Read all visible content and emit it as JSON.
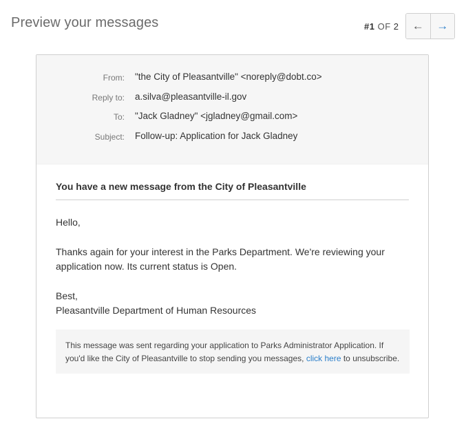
{
  "header": {
    "title": "Preview your messages",
    "pager": {
      "current": "#1",
      "of_label": "OF",
      "total": "2"
    },
    "nav": {
      "prev_glyph": "←",
      "next_glyph": "→"
    }
  },
  "email": {
    "headers": [
      {
        "label": "From:",
        "value": "\"the City of Pleasantville\" <noreply@dobt.co>"
      },
      {
        "label": "Reply to:",
        "value": "a.silva@pleasantville-il.gov"
      },
      {
        "label": "To:",
        "value": "\"Jack Gladney\" <jgladney@gmail.com>"
      },
      {
        "label": "Subject:",
        "value": "Follow-up: Application for Jack Gladney"
      }
    ],
    "heading": "You have a new message from the City of Pleasantville",
    "greeting": "Hello,",
    "paragraph": "Thanks again for your interest in the Parks Department. We're reviewing your application now. Its current status is Open.",
    "closing": "Best,",
    "signature": "Pleasantville Department of Human Resources",
    "footer": {
      "text_before": "This message was sent regarding your application to Parks Administrator Application. If you'd like the City of Pleasantville to stop sending you messages, ",
      "link": "click here",
      "text_after": " to unsubscribe."
    }
  },
  "colors": {
    "link": "#2a7ec9",
    "header_bg": "#f6f6f6",
    "note_bg": "#f5f5f5"
  }
}
